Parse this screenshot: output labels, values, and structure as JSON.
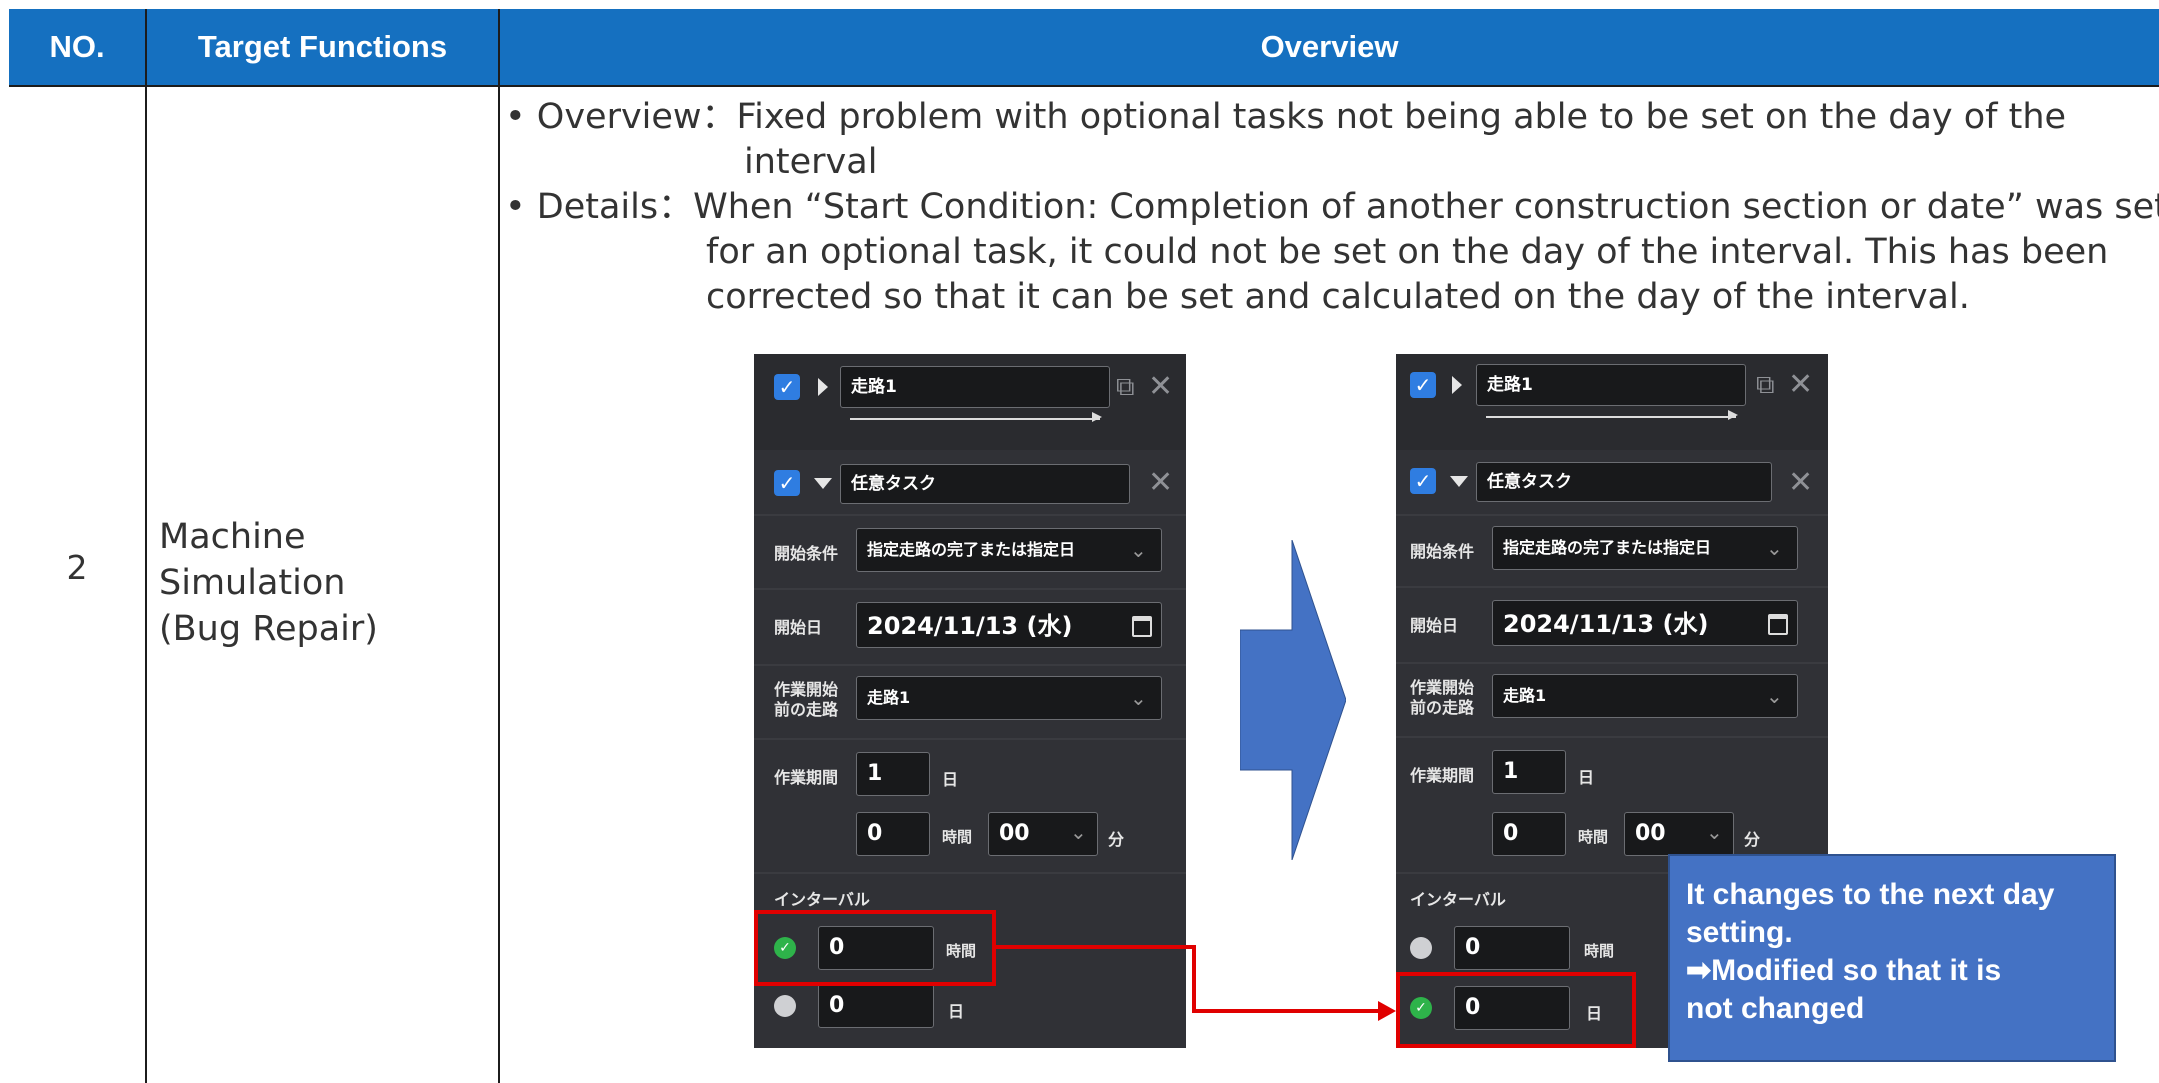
{
  "table": {
    "headers": [
      "NO.",
      "Target Functions",
      "Overview"
    ],
    "row": {
      "no": "2",
      "target_function_lines": [
        "Machine",
        "Simulation",
        "(Bug Repair)"
      ],
      "overview_lines": [
        "• Overview：Fixed problem with optional tasks not being able to be set on the day of the",
        "interval",
        "• Details：When “Start Condition: Completion of another construction section or date” was set",
        "for an optional task, it could not be set on the day of the interval. This has been",
        "corrected so that it can be set and calculated on the day of the interval."
      ]
    }
  },
  "screens": {
    "before": {
      "section_name": "走路1",
      "task_name": "任意タスク",
      "start_condition_label": "開始条件",
      "start_condition_value": "指定走路の完了または指定日",
      "start_date_label": "開始日",
      "start_date_value": "2024/11/13 (水)",
      "prev_section_label_1": "作業開始",
      "prev_section_label_2": "前の走路",
      "prev_section_value": "走路1",
      "work_period_label": "作業期間",
      "work_days_value": "1",
      "day_unit": "日",
      "work_hours_value": "0",
      "hour_unit": "時間",
      "minutes_value": "00",
      "minute_unit": "分",
      "interval_label": "インターバル",
      "interval_hours_value": "0",
      "interval_days_value": "0",
      "selected_interval": "hours"
    },
    "after": {
      "section_name": "走路1",
      "task_name": "任意タスク",
      "start_condition_label": "開始条件",
      "start_condition_value": "指定走路の完了または指定日",
      "start_date_label": "開始日",
      "start_date_value": "2024/11/13 (水)",
      "prev_section_label_1": "作業開始",
      "prev_section_label_2": "前の走路",
      "prev_section_value": "走路1",
      "work_period_label": "作業期間",
      "work_days_value": "1",
      "day_unit": "日",
      "work_hours_value": "0",
      "hour_unit": "時間",
      "minutes_value": "00",
      "minute_unit": "分",
      "interval_label": "インターバル",
      "interval_hours_value": "0",
      "interval_days_value": "0",
      "selected_interval": "days"
    }
  },
  "callout": {
    "lines": [
      "It changes to the next day",
      "setting.",
      "➡Modified so that it is",
      "not changed"
    ]
  },
  "colors": {
    "header_bg": "#1570c0",
    "arrow": "#4472c4",
    "highlight": "#e00000",
    "callout_bg": "#4472c4"
  }
}
